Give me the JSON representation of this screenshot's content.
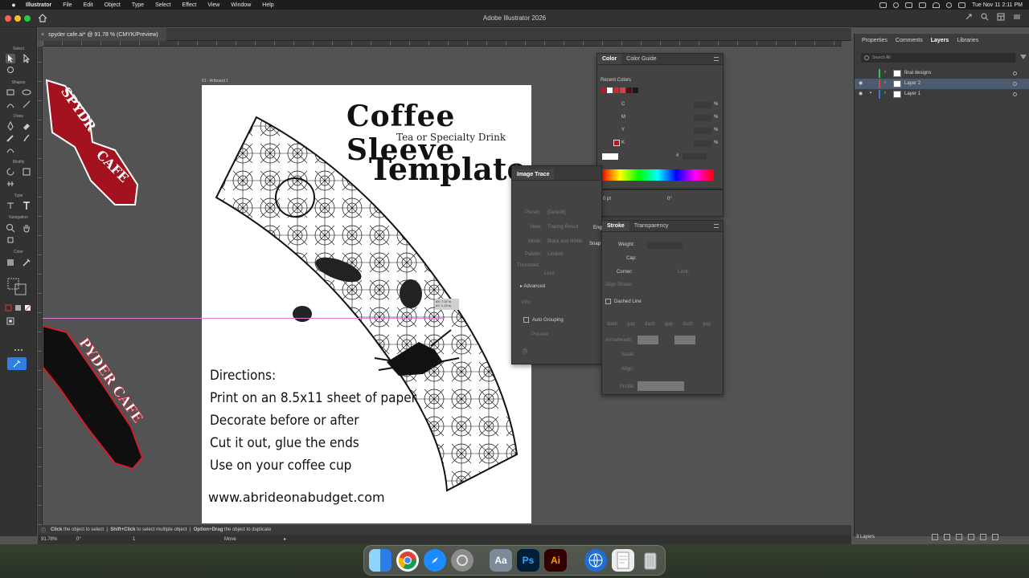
{
  "menubar": {
    "app": "Illustrator",
    "items": [
      "File",
      "Edit",
      "Object",
      "Type",
      "Select",
      "Effect",
      "View",
      "Window",
      "Help"
    ],
    "datetime": "Tue Nov 11  2:11 PM"
  },
  "window": {
    "title": "Adobe Illustrator 2026"
  },
  "document": {
    "tab": "spyder cafe.ai* @ 91.78 % (CMYK/Preview)",
    "artboard_label": "01 - Artboard 1"
  },
  "toolbar": {
    "sections": [
      "Select",
      "Shapes",
      "Draw",
      "Modify",
      "Type",
      "Navigation",
      "Color"
    ]
  },
  "artwork": {
    "title": "Coffee Sleeve",
    "subtitle": "Tea or Specialty Drink",
    "template": "Template",
    "directions": [
      "Directions:",
      "Print on an 8.5x11 sheet of paper",
      "Decorate before or after",
      "Cut it out, glue the ends",
      "Use on your coffee cup"
    ],
    "website": "www.abrideonabudget.com",
    "tip": [
      "dX: 7.37 in",
      "dY: 1.13 in"
    ]
  },
  "color_panel": {
    "tabs": [
      "Color",
      "Color Guide"
    ],
    "recent": "Recent Colors",
    "channels": [
      "C",
      "M",
      "Y",
      "K"
    ],
    "pct": "%",
    "hash": "#",
    "colors": [
      "#c1121f",
      "#ffffff",
      "#d62828",
      "#e63946",
      "#5e0b15",
      "#1a1a1a"
    ]
  },
  "char_panel": {
    "size": "0 pt",
    "angle": "0°"
  },
  "image_trace": {
    "title": "Image Trace",
    "labels": [
      "Preset:",
      "View:",
      "Mode:",
      "Palette:",
      "Threshold:"
    ],
    "values": [
      "[Default]",
      "Tracing Result",
      "Black and White",
      "Limited"
    ],
    "less": "Less",
    "advanced": "Advanced",
    "info": "Info:",
    "auto_grouping": "Auto Grouping",
    "preview": "Preview"
  },
  "stroke_panel": {
    "tabs": [
      "Stroke",
      "Transparency"
    ],
    "weight": "Weight:",
    "cap": "Cap:",
    "corner": "Corner:",
    "limit": "Limit:",
    "align": "Align Stroke:",
    "dashed": "Dashed Line",
    "dash_labels": [
      "dash",
      "gap",
      "dash",
      "gap",
      "dash",
      "gap"
    ],
    "arrowheads": "Arrowheads:",
    "scale": "Scale:",
    "align2": "Align:",
    "profile": "Profile:",
    "side_labels": [
      "Eng",
      "Snap"
    ]
  },
  "right_panel": {
    "tabs": [
      "Properties",
      "Comments",
      "Layers",
      "Libraries"
    ],
    "search": "Search All",
    "layers": [
      "final designs",
      "Layer 2",
      "Layer 1"
    ],
    "count": "3 Layers"
  },
  "status": {
    "hint": [
      "Click",
      " the object to select  |  ",
      "Shift+Click",
      " to select multiple object  |  ",
      "Option+Drag",
      " the object to duplicate"
    ],
    "zoom": "91.78%",
    "angle": "0°",
    "page": "1",
    "mode": "Move"
  }
}
